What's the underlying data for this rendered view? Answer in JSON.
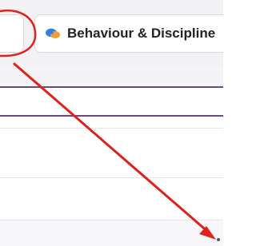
{
  "toolbar": {
    "behaviour_button_label": "Behaviour & Discipline",
    "behaviour_icon": "chat-bubbles-icon"
  },
  "annotation": {
    "color": "#e0201c",
    "shapes": [
      "ellipse-highlight",
      "arrow"
    ]
  },
  "colors": {
    "highlight_border": "#6b4a7a",
    "icon_blue": "#2f80e6",
    "icon_orange": "#f39c32"
  }
}
